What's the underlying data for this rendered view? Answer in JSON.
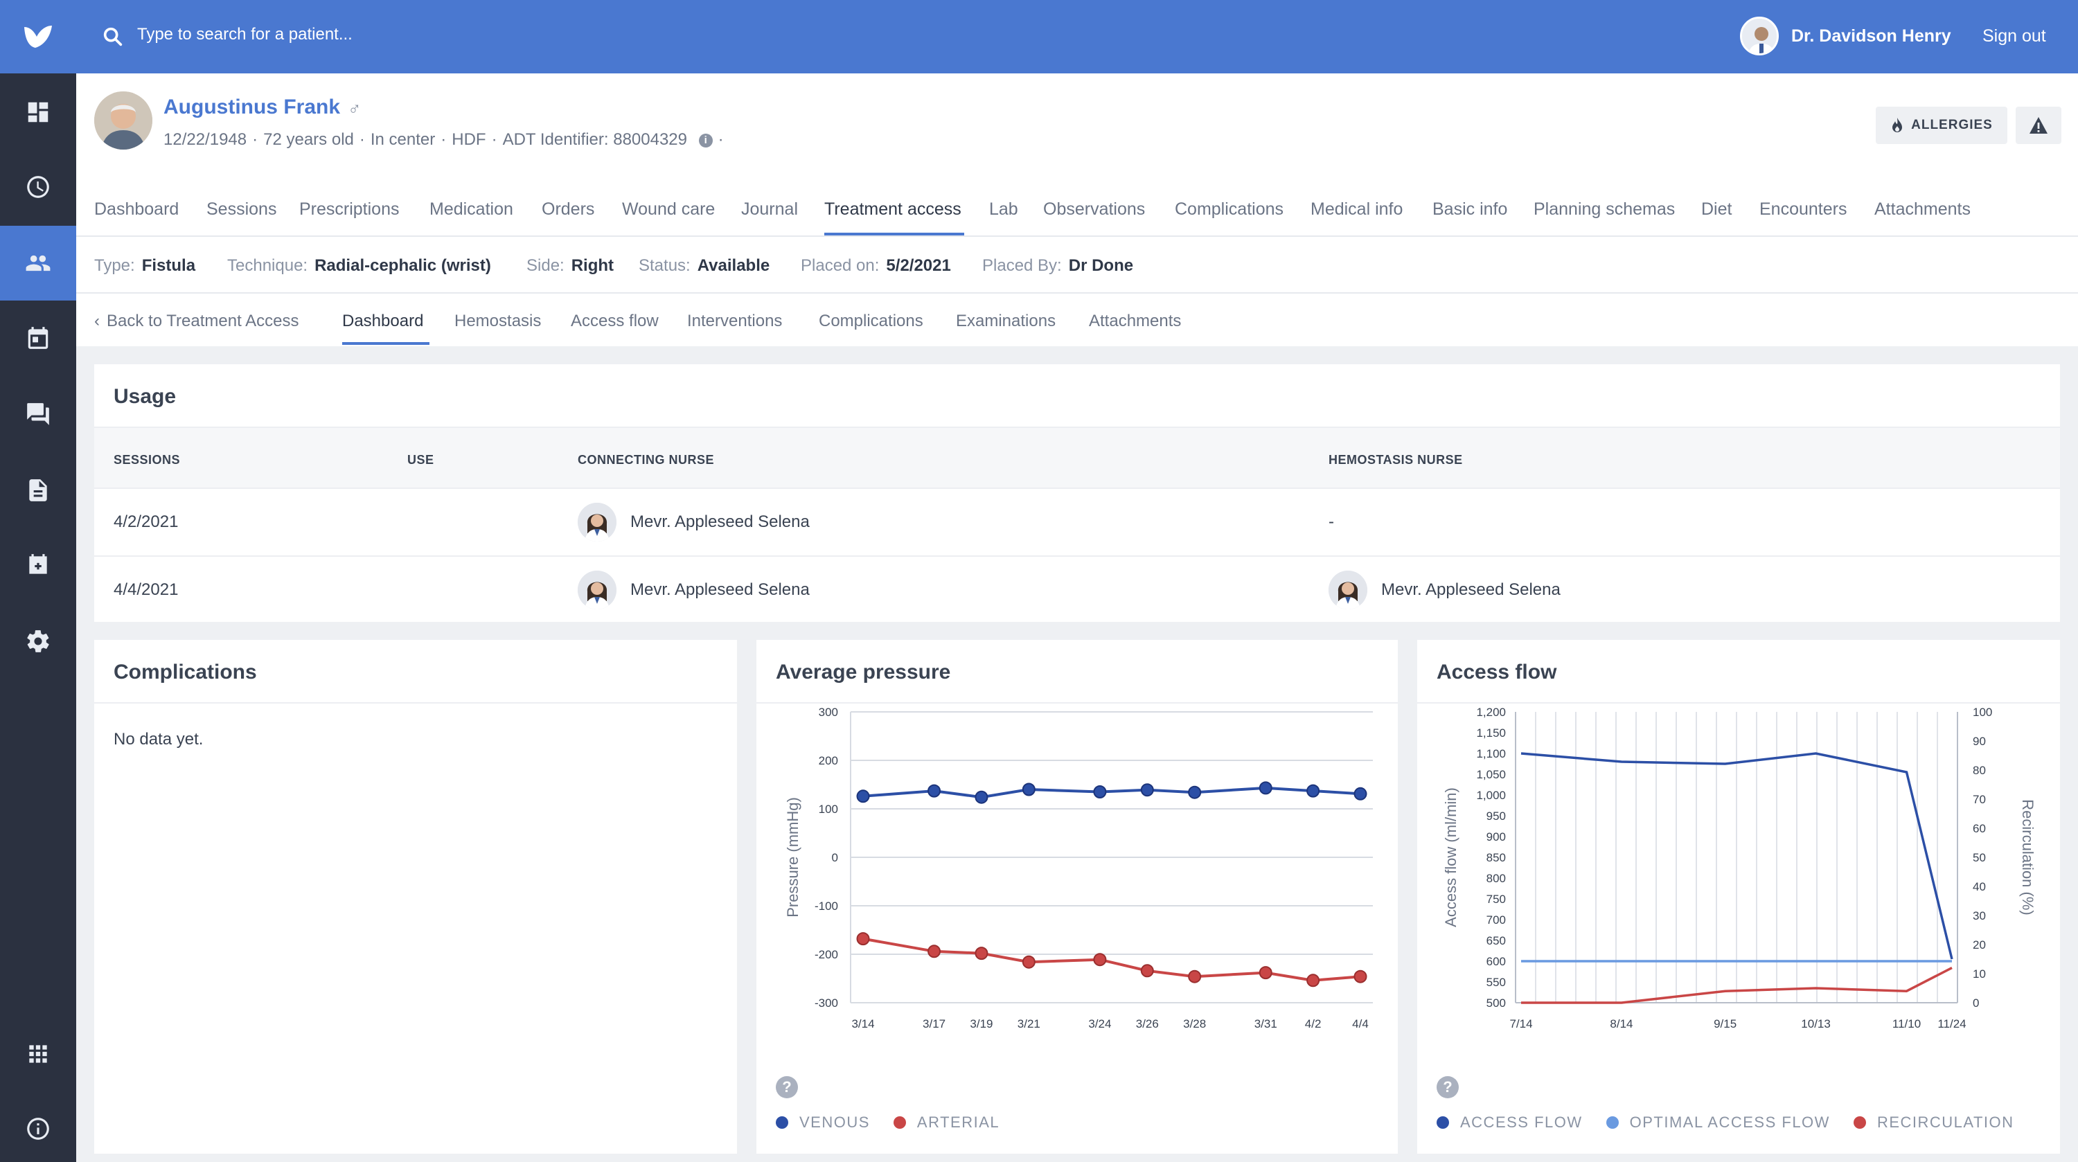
{
  "topbar": {
    "search_placeholder": "Type to search for a patient...",
    "user_name": "Dr. Davidson Henry",
    "signout_label": "Sign out"
  },
  "patient": {
    "name": "Augustinus Frank",
    "gender_symbol": "♂",
    "dob": "12/22/1948",
    "age": "72 years old",
    "location": "In center",
    "modality": "HDF",
    "adt": "ADT Identifier: 88004329",
    "allergies_label": "ALLERGIES"
  },
  "main_tabs": [
    "Dashboard",
    "Sessions",
    "Prescriptions",
    "Medication",
    "Orders",
    "Wound care",
    "Journal",
    "Treatment access",
    "Lab",
    "Observations",
    "Complications",
    "Medical info",
    "Basic info",
    "Planning schemas",
    "Diet",
    "Encounters",
    "Attachments"
  ],
  "active_main_tab": "Treatment access",
  "access_info": [
    {
      "label": "Type:",
      "value": "Fistula"
    },
    {
      "label": "Technique:",
      "value": "Radial-cephalic (wrist)"
    },
    {
      "label": "Side:",
      "value": "Right"
    },
    {
      "label": "Status:",
      "value": "Available"
    },
    {
      "label": "Placed on:",
      "value": "5/2/2021"
    },
    {
      "label": "Placed By:",
      "value": "Dr Done"
    }
  ],
  "sub_tabs": {
    "back_label": "Back to Treatment Access",
    "items": [
      "Dashboard",
      "Hemostasis",
      "Access flow",
      "Interventions",
      "Complications",
      "Examinations",
      "Attachments"
    ],
    "active": "Dashboard"
  },
  "usage": {
    "title": "Usage",
    "columns": [
      "SESSIONS",
      "USE",
      "CONNECTING NURSE",
      "HEMOSTASIS NURSE"
    ],
    "rows": [
      {
        "session": "4/2/2021",
        "use": "",
        "connecting": "Mevr. Appleseed Selena",
        "hemostasis": "-"
      },
      {
        "session": "4/4/2021",
        "use": "",
        "connecting": "Mevr. Appleseed Selena",
        "hemostasis": "Mevr. Appleseed Selena"
      }
    ]
  },
  "complications": {
    "title": "Complications",
    "empty_text": "No data yet."
  },
  "colors": {
    "venous": "#2c4fa6",
    "arterial": "#c94646",
    "access_flow": "#2c4fa6",
    "optimal": "#6a9ae0",
    "recirculation": "#c94646"
  },
  "chart_data": [
    {
      "type": "line",
      "title": "Average pressure",
      "ylabel": "Pressure (mmHg)",
      "ylim": [
        -300,
        300
      ],
      "yticks": [
        300,
        200,
        100,
        0,
        -100,
        -200,
        -300
      ],
      "x": [
        "3/14",
        "3/17",
        "3/19",
        "3/21",
        "3/24",
        "3/26",
        "3/28",
        "3/31",
        "4/2",
        "4/4"
      ],
      "series": [
        {
          "name": "VENOUS",
          "values": [
            126,
            137,
            124,
            140,
            135,
            139,
            134,
            143,
            137,
            131
          ]
        },
        {
          "name": "ARTERIAL",
          "values": [
            -168,
            -194,
            -198,
            -216,
            -211,
            -234,
            -246,
            -238,
            -254,
            -246
          ]
        }
      ],
      "grid": true,
      "legend": "bottom-left"
    },
    {
      "type": "line",
      "title": "Access flow",
      "ylabel": "Access flow (ml/min)",
      "ylabel_right": "Recirculation (%)",
      "ylim": [
        500,
        1200
      ],
      "yticks": [
        "1,200",
        "1,150",
        "1,100",
        "1,050",
        "1,000",
        "950",
        "900",
        "850",
        "800",
        "750",
        "700",
        "650",
        "600",
        "550",
        "500"
      ],
      "ylim_right": [
        0,
        100
      ],
      "yticks_right": [
        100,
        90,
        80,
        70,
        60,
        50,
        40,
        30,
        20,
        10,
        0
      ],
      "x": [
        "7/14",
        "8/14",
        "9/15",
        "10/13",
        "11/10",
        "11/24"
      ],
      "series": [
        {
          "name": "ACCESS FLOW",
          "points": [
            [
              0,
              1100
            ],
            [
              1,
              1080
            ],
            [
              2,
              1075
            ],
            [
              3,
              1100
            ],
            [
              4,
              1055
            ],
            [
              5,
              605
            ]
          ]
        },
        {
          "name": "OPTIMAL ACCESS FLOW",
          "points": [
            [
              0,
              600
            ],
            [
              5,
              600
            ]
          ]
        },
        {
          "name": "RECIRCULATION",
          "axis": "right",
          "points": [
            [
              0,
              0
            ],
            [
              1,
              0
            ],
            [
              2,
              4
            ],
            [
              3,
              5
            ],
            [
              4,
              4
            ],
            [
              5,
              12
            ]
          ]
        }
      ],
      "grid": true,
      "legend": "bottom-left"
    }
  ]
}
